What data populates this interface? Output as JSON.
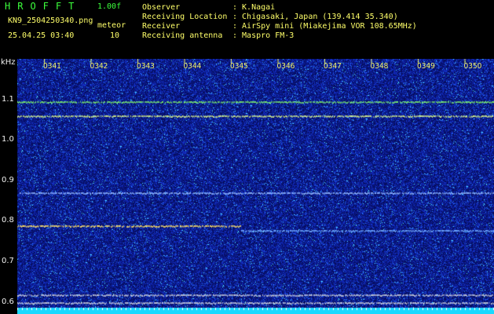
{
  "header": {
    "program_name": "HROFFT",
    "version": "1.00f",
    "filename": "KN9_2504250340.png",
    "label_mode": "meteor",
    "count": "10",
    "datetime": "25.04.25 03:40",
    "observer_label": "Observer",
    "observer_value": ": K.Nagai",
    "location_label": "Receiving Location",
    "location_value": ": Chigasaki, Japan (139.414 35.340)",
    "receiver_label": "Receiver",
    "receiver_value": ": AirSpy mini (Miakejima VOR 108.65MHz)",
    "antenna_label": "Receiving antenna",
    "antenna_value": ": Maspro FM-3"
  },
  "spectrogram": {
    "y_unit": "kHz",
    "y_ticks": [
      "1.1",
      "1.0",
      "0.9",
      "0.8",
      "0.7",
      "0.6"
    ],
    "y_tick_values": [
      1.1,
      1.0,
      0.9,
      0.8,
      0.7,
      0.6
    ],
    "y_range": [
      0.57,
      1.2
    ],
    "time_labels": [
      "0341",
      "0342",
      "0343",
      "0344",
      "0345",
      "0346",
      "0347",
      "0348",
      "0349",
      "0350"
    ],
    "traces": [
      {
        "name": "carrier-1.09",
        "freq_khz": 1.093,
        "start_frac": 0.0,
        "end_frac": 1.0,
        "color": "#7cf06a"
      },
      {
        "name": "carrier-1.06",
        "freq_khz": 1.058,
        "start_frac": 0.0,
        "end_frac": 1.0,
        "color": "#d8f28a"
      },
      {
        "name": "carrier-0.87",
        "freq_khz": 0.868,
        "start_frac": 0.0,
        "end_frac": 1.0,
        "color": "#8fb6ff"
      },
      {
        "name": "meteor-echo-0.78",
        "freq_khz": 0.787,
        "start_frac": 0.0,
        "end_frac": 0.47,
        "color": "#ffe066"
      },
      {
        "name": "carrier-0.775",
        "freq_khz": 0.775,
        "start_frac": 0.47,
        "end_frac": 1.0,
        "color": "#6fa8ff"
      },
      {
        "name": "line-0.615",
        "freq_khz": 0.617,
        "start_frac": 0.0,
        "end_frac": 1.0,
        "color": "#c8ccdd"
      },
      {
        "name": "line-0.60",
        "freq_khz": 0.598,
        "start_frac": 0.0,
        "end_frac": 1.0,
        "color": "#c8ccdd"
      }
    ],
    "colors": {
      "background": "#0a1070",
      "noise_low": "#1224b0",
      "noise_mid": "#2a66ff",
      "noise_high": "#39d0ff",
      "bottom_band": "#19d9ff"
    }
  }
}
